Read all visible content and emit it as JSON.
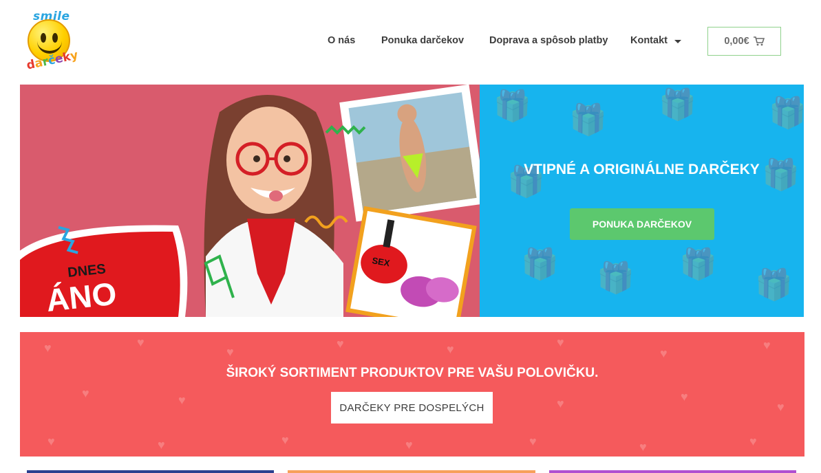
{
  "brand": {
    "logo_top": "smile",
    "logo_bottom": [
      "d",
      "a",
      "r",
      "č",
      "e",
      "k",
      "y"
    ]
  },
  "nav": {
    "items": [
      "O nás",
      "Ponuka darčekov",
      "Doprava a spôsob platby",
      "Kontakt"
    ],
    "kontakt_icon": "chevron-down-icon"
  },
  "cart": {
    "total": "0,00€",
    "icon": "cart-icon"
  },
  "hero": {
    "title": "VTIPNÉ A ORIGINÁLNE DARČEKY",
    "button_label": "PONUKA DARČEKOV",
    "background_color": "#17b4ee",
    "button_color": "#5cc86e",
    "image_texts": [
      "DNES",
      "ÁNO",
      "SEX"
    ]
  },
  "band": {
    "title": "ŠIROKÝ SORTIMENT PRODUKTOV PRE VAŠU POLOVIČKU.",
    "button_label": "DARČEKY PRE DOSPELÝCH",
    "background_color": "#f55a5c"
  }
}
